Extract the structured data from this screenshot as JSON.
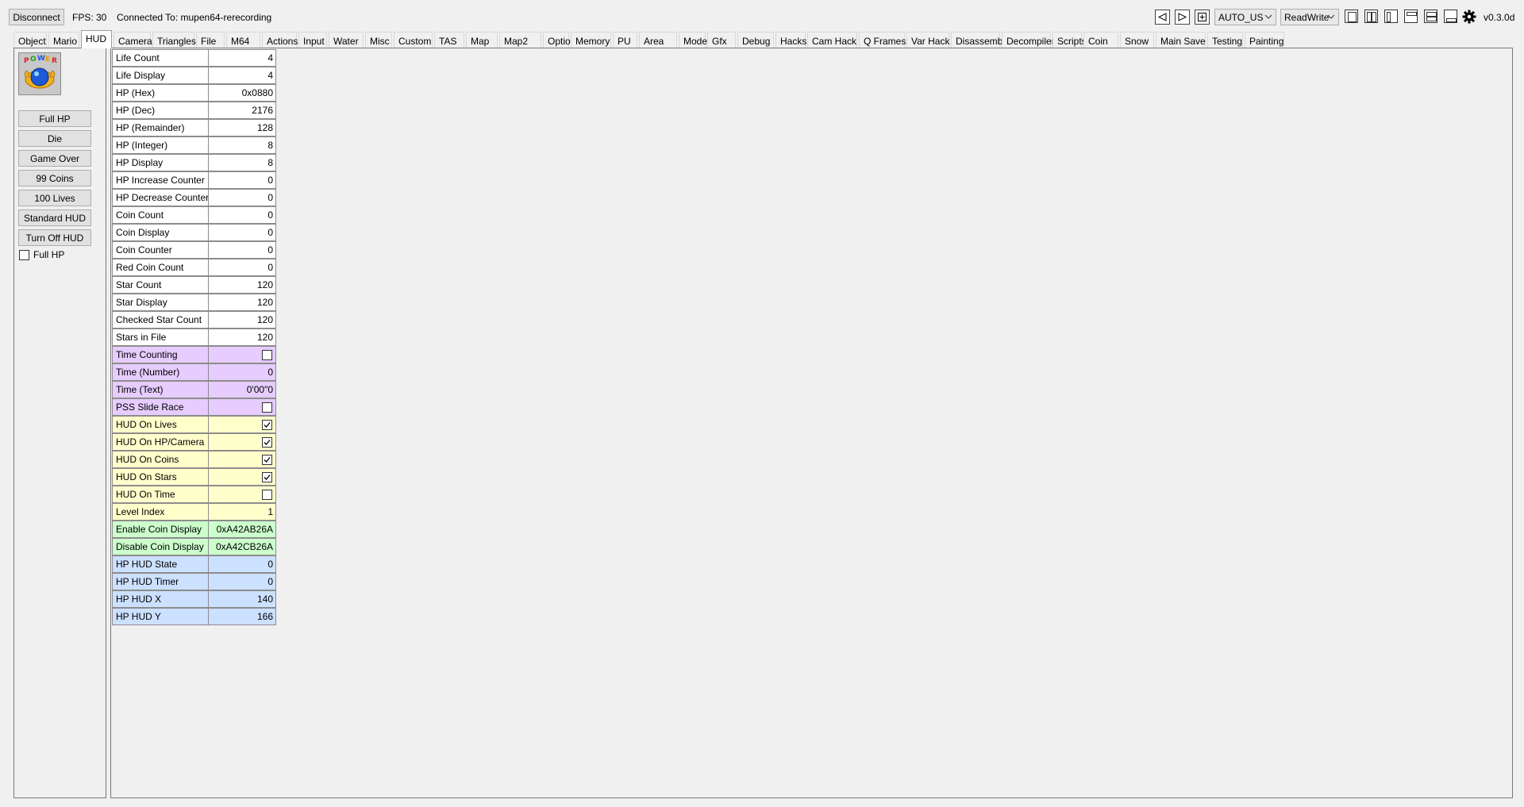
{
  "topbar": {
    "disconnect_label": "Disconnect",
    "fps_text": "FPS: 30",
    "connected_text": "Connected To: mupen64-rerecording",
    "mode_combo": "AUTO_US",
    "access_combo": "ReadWrite",
    "version": "v0.3.0d"
  },
  "tabs": [
    "Object",
    "Mario",
    "HUD",
    "Camera",
    "Triangles",
    "File",
    "M64",
    "Actions",
    "Input",
    "Water",
    "Misc",
    "Custom",
    "TAS",
    "Map",
    "Map2",
    "Options",
    "Memory",
    "PU",
    "Area",
    "Model",
    "Gfx",
    "Debug",
    "Hacks",
    "Cam Hack",
    "Q Frames",
    "Var Hack",
    "Disassembly",
    "Decompiler",
    "Scripts",
    "Coin",
    "Snow",
    "Main Save",
    "Testing",
    "Painting"
  ],
  "active_tab": "HUD",
  "side": {
    "buttons": [
      "Full HP",
      "Die",
      "Game Over",
      "99 Coins",
      "100 Lives",
      "Standard HUD",
      "Turn Off HUD"
    ],
    "checkbox_label": "Full HP",
    "checkbox_checked": false,
    "portrait_icon": "power-meter-icon"
  },
  "variables": [
    {
      "name": "Life Count",
      "value": "4",
      "color": "white"
    },
    {
      "name": "Life Display",
      "value": "4",
      "color": "white"
    },
    {
      "name": "HP (Hex)",
      "value": "0x0880",
      "color": "white"
    },
    {
      "name": "HP (Dec)",
      "value": "2176",
      "color": "white"
    },
    {
      "name": "HP (Remainder)",
      "value": "128",
      "color": "white"
    },
    {
      "name": "HP (Integer)",
      "value": "8",
      "color": "white"
    },
    {
      "name": "HP Display",
      "value": "8",
      "color": "white"
    },
    {
      "name": "HP Increase Counter",
      "value": "0",
      "color": "white"
    },
    {
      "name": "HP Decrease Counter",
      "value": "0",
      "color": "white"
    },
    {
      "name": "Coin Count",
      "value": "0",
      "color": "white"
    },
    {
      "name": "Coin Display",
      "value": "0",
      "color": "white"
    },
    {
      "name": "Coin Counter",
      "value": "0",
      "color": "white"
    },
    {
      "name": "Red Coin Count",
      "value": "0",
      "color": "white"
    },
    {
      "name": "Star Count",
      "value": "120",
      "color": "white"
    },
    {
      "name": "Star Display",
      "value": "120",
      "color": "white"
    },
    {
      "name": "Checked Star Count",
      "value": "120",
      "color": "white"
    },
    {
      "name": "Stars in File",
      "value": "120",
      "color": "white"
    },
    {
      "name": "Time Counting",
      "checkbox": false,
      "color": "purple"
    },
    {
      "name": "Time (Number)",
      "value": "0",
      "color": "purple"
    },
    {
      "name": "Time (Text)",
      "value": "0'00\"0",
      "color": "purple"
    },
    {
      "name": "PSS Slide Race",
      "checkbox": false,
      "color": "purple"
    },
    {
      "name": "HUD On Lives",
      "checkbox": true,
      "color": "yellow"
    },
    {
      "name": "HUD On HP/Camera",
      "checkbox": true,
      "color": "yellow"
    },
    {
      "name": "HUD On Coins",
      "checkbox": true,
      "color": "yellow"
    },
    {
      "name": "HUD On Stars",
      "checkbox": true,
      "color": "yellow"
    },
    {
      "name": "HUD On Time",
      "checkbox": false,
      "color": "yellow"
    },
    {
      "name": "Level Index",
      "value": "1",
      "color": "yellow"
    },
    {
      "name": "Enable Coin Display",
      "value": "0xA42AB26A",
      "color": "green"
    },
    {
      "name": "Disable Coin Display",
      "value": "0xA42CB26A",
      "color": "green"
    },
    {
      "name": "HP HUD State",
      "value": "0",
      "color": "blue"
    },
    {
      "name": "HP HUD Timer",
      "value": "0",
      "color": "blue"
    },
    {
      "name": "HP HUD X",
      "value": "140",
      "color": "blue"
    },
    {
      "name": "HP HUD Y",
      "value": "166",
      "color": "blue"
    }
  ],
  "colors": {
    "purple": "#e6ccff",
    "yellow": "#ffffcc",
    "green": "#ccffcc",
    "blue": "#cce0ff"
  }
}
